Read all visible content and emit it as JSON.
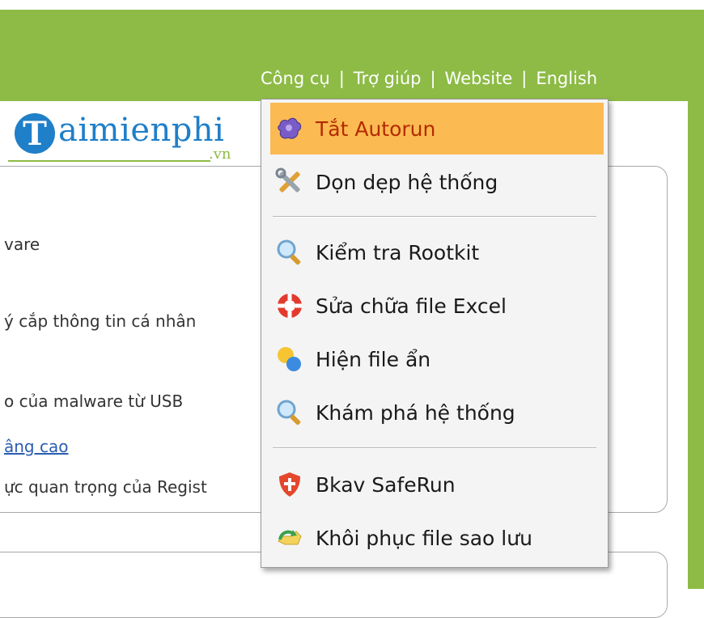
{
  "header": {
    "menu": [
      {
        "label": "Công cụ"
      },
      {
        "label": "Trợ giúp"
      },
      {
        "label": "Website"
      },
      {
        "label": "English"
      }
    ],
    "separator": "|"
  },
  "logo": {
    "letter": "T",
    "text": "aimienphi",
    "suffix": ".vn"
  },
  "panel_text": {
    "line1": "vare",
    "line2": "ý cắp thông tin cá nhân",
    "line3": "o của malware từ USB",
    "line4": "âng cao",
    "line5": "ực quan trọng của Regist"
  },
  "dropdown": {
    "items": [
      {
        "label": "Tắt Autorun",
        "icon": "gear-puzzle-icon",
        "highlighted": true
      },
      {
        "label": "Dọn dẹp hệ thống",
        "icon": "tools-icon"
      },
      {
        "label": "Kiểm tra Rootkit",
        "icon": "magnifier-icon"
      },
      {
        "label": "Sửa chữa file Excel",
        "icon": "lifebuoy-icon"
      },
      {
        "label": "Hiện file ẩn",
        "icon": "bubbles-icon"
      },
      {
        "label": "Khám phá hệ thống",
        "icon": "magnifier-icon"
      },
      {
        "label": "Bkav SafeRun",
        "icon": "shield-icon"
      },
      {
        "label": "Khôi phục file sao lưu",
        "icon": "restore-icon"
      }
    ]
  },
  "colors": {
    "header_green": "#8dbb46",
    "highlight": "#fbba52",
    "highlight_text": "#b32b00",
    "logo_blue": "#1f7fc9"
  }
}
